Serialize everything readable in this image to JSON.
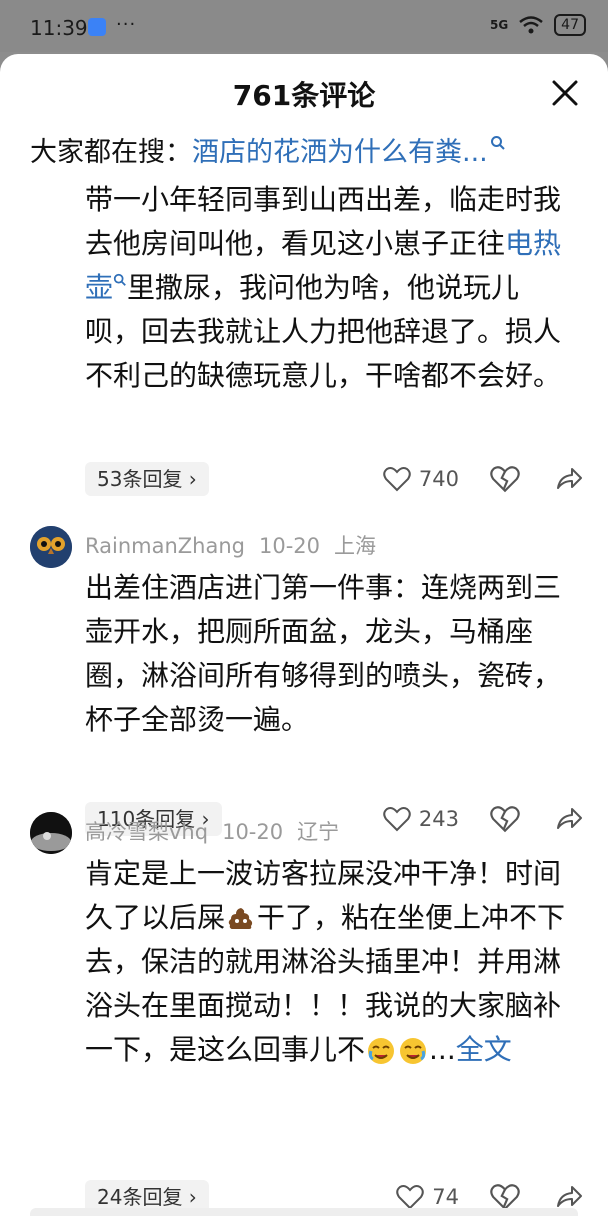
{
  "status_bar": {
    "time": "11:39",
    "more": "···",
    "signal": "5G",
    "battery": "47"
  },
  "sheet": {
    "title": "761条评论"
  },
  "search": {
    "prefix": "大家都在搜：",
    "query": "酒店的花洒为什么有粪..."
  },
  "comments": [
    {
      "text_before": "带一小年轻同事到山西出差，临走时我去他房间叫他，看见这小崽子正往",
      "link": "电热壶",
      "text_after": "里撒尿，我问他为啥，他说玩儿呗，回去我就让人力把他辞退了。损人不利己的缺德玩意儿，干啥都不会好。",
      "replies": "53条回复 ›",
      "likes": "740"
    },
    {
      "username": "RainmanZhang",
      "date": "10-20",
      "location": "上海",
      "text": "出差住酒店进门第一件事：连烧两到三壶开水，把厕所面盆，龙头，马桶座圈，淋浴间所有够得到的喷头，瓷砖，杯子全部烫一遍。",
      "replies": "110条回复 ›",
      "likes": "243"
    },
    {
      "username": "高冷雪梨vhq",
      "date": "10-20",
      "location": "辽宁",
      "text_a": "肯定是上一波访客拉屎没冲干净！时间久了以后屎",
      "text_b": "干了，粘在坐便上冲不下去，保洁的就用淋浴头插里冲！并用淋浴头在里面搅动！！！我说的大家脑补一下，是这么回事儿不",
      "ellipsis": "...",
      "full_text": "全文",
      "replies": "24条回复 ›",
      "likes": "74"
    }
  ],
  "icons": [
    "close-icon",
    "search-icon",
    "heart-icon",
    "broken-heart-icon",
    "share-icon",
    "poop-emoji",
    "crying-emoji"
  ],
  "colors": {
    "link": "#2f6fb8",
    "meta": "#9a9a9a",
    "pill_bg": "#f2f2f2"
  }
}
